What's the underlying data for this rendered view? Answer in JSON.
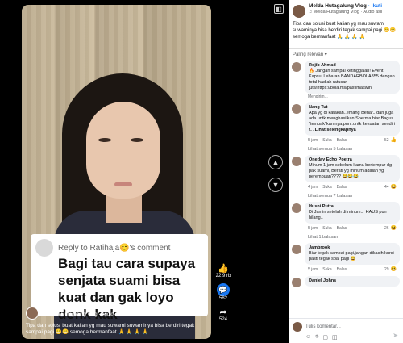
{
  "video": {
    "reply_label": "Reply to Ratihaja😊's comment",
    "reply_text": "Bagi tau cara supaya senjata suami bisa kuat dan gak loyo donk kak",
    "overlay_name": "Melda Hutagalung Vlog",
    "overlay_audio": "♫ Melda Hutagalung Vlog · Audio asli",
    "overlay_caption": "Tipa dan solusi buat kalian yg mau suwami suwaminya bisa berdiri tegak sampai pagi 😁😁 semoga bermanfaat 🙏 🙏 🙏 🙏"
  },
  "actions": {
    "like_count": "22,9 rb",
    "comment_count": "582",
    "share_count": "524"
  },
  "panel": {
    "page_name": "Melda Hutagalung Vlog",
    "follow_label": "· Ikuti",
    "audio": "♫ Melda Hutagalung Vlog · Audio asli",
    "caption": "Tipa dan solusi buat kalian yg mau suwami suwaminya bisa berdiri tegak sampai pagi 😁😁 semoga bermanfaat 🙏 🙏 🙏 🙏",
    "sort_label": "Paling relevan ▾",
    "input_placeholder": "Tulis komentar..."
  },
  "comments": [
    {
      "author": "Rojib Ahmad",
      "text": "🔥 Jangan sampai ketinggalan! Event Kapsul Lebaran BANDARBOLA855 dengan total hadiah ratusan juta!https://bola.ms/pastimaswin",
      "extra": "Mengirim..."
    },
    {
      "author": "Nang Tut",
      "text": "Apa yg di katakan..emang Benar...dan juga ada untk menghasilkan Sperma biar Bagus \"tembak\"kan nya,pun..untk kekuatan sendiri t...",
      "more": "Lihat selengkapnya",
      "time": "5 jam",
      "like": "Suka",
      "reply": "Balas",
      "count": "52",
      "replies": "Lihat semua 5 balasan"
    },
    {
      "author": "Oneday Echo Poetra",
      "text": "Minum 1 jam sebelum kamu bertempur dg pak suami, Berati yg minum adalah yg perempuan???? 😂😂😂",
      "time": "4 jam",
      "like": "Suka",
      "reply": "Balas",
      "count": "44",
      "replies": "Lihat semua 7 balasan"
    },
    {
      "author": "Husni Putra",
      "text": "Di Jamin setelah di minum... HAUS pun hilang..",
      "time": "5 jam",
      "like": "Suka",
      "reply": "Balas",
      "count": "26",
      "replies": "Lihat 1 balasan"
    },
    {
      "author": "Jambrook",
      "text": "Biar tegak sampai pagi,jangan dikasih kursi pasti tegak spai pagi 😂",
      "time": "5 jam",
      "like": "Suka",
      "reply": "Balas",
      "count": "29"
    },
    {
      "author": "Daniel Johns",
      "text": ""
    }
  ]
}
